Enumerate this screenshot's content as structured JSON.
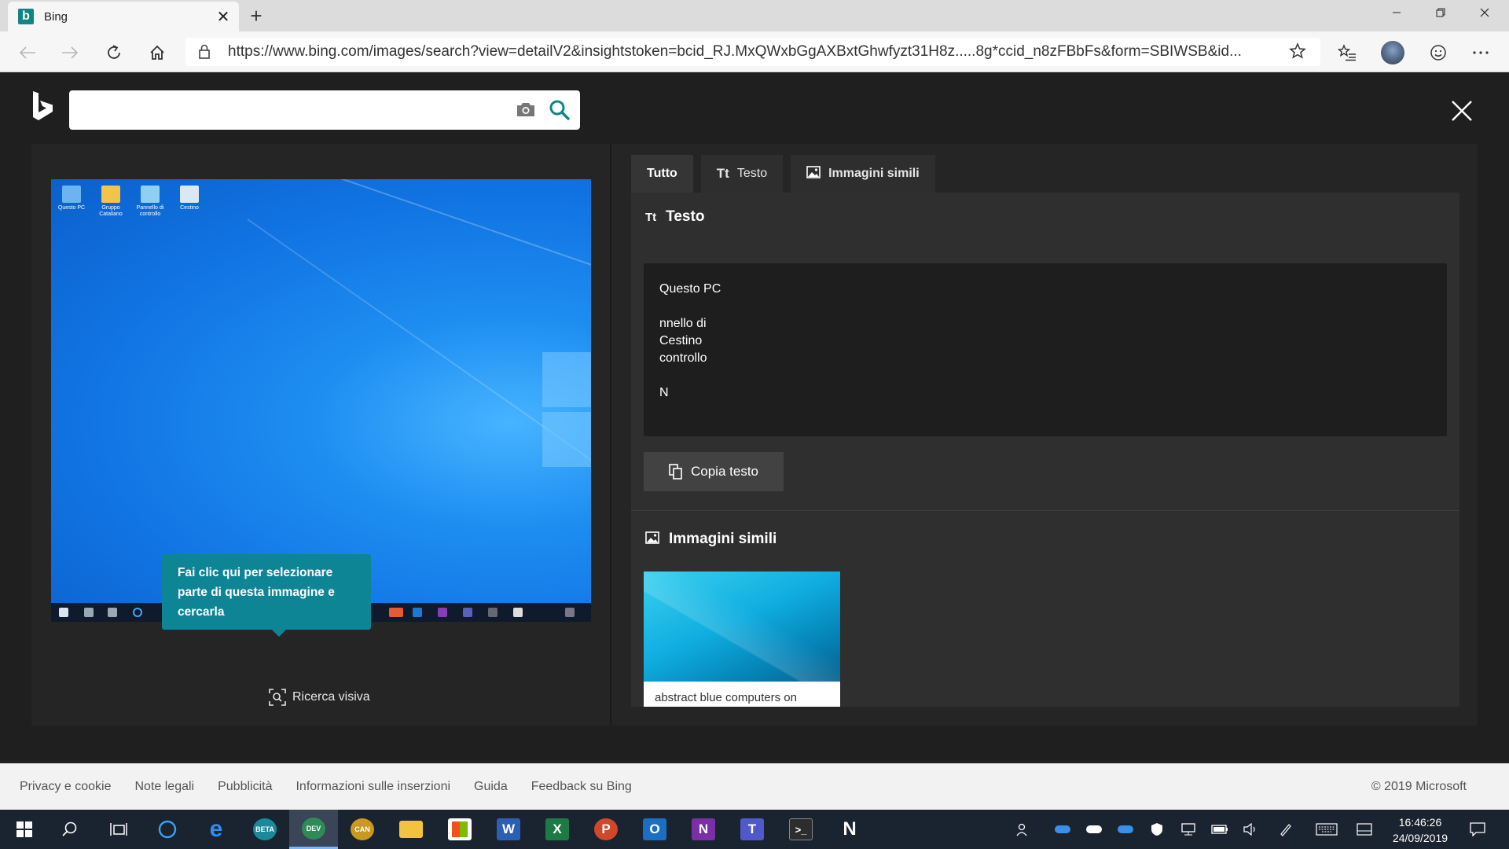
{
  "browser": {
    "tab_title": "Bing",
    "new_tab": "+",
    "url": "https://www.bing.com/images/search?view=detailV2&insightstoken=bcid_RJ.MxQWxbGgAXBxtGhwfyzt31H8z.....8g*ccid_n8zFBbFs&form=SBIWSB&id..."
  },
  "search": {
    "query": ""
  },
  "preview": {
    "desktop_icons": [
      "Questo PC",
      "Gruppo Cataliano",
      "Pannello di controllo",
      "Cestino"
    ],
    "tooltip": "Fai clic qui per selezionare parte di questa immagine e cercarla",
    "visual_search_label": "Ricerca visiva"
  },
  "tabs": [
    {
      "label": "Tutto",
      "icon": "none"
    },
    {
      "label": "Testo",
      "icon": "text-icon"
    },
    {
      "label": "Immagini simili",
      "icon": "image-icon"
    }
  ],
  "text_section": {
    "title": "Testo",
    "lines": [
      "Questo PC",
      "",
      "nnello di",
      "Cestino",
      "controllo",
      "",
      "N"
    ],
    "copy_button": "Copia testo"
  },
  "similar_section": {
    "title": "Immagini simili",
    "items": [
      {
        "caption": "abstract blue computers on"
      }
    ]
  },
  "footer": {
    "links": [
      "Privacy e cookie",
      "Note legali",
      "Pubblicità",
      "Informazioni sulle inserzioni",
      "Guida",
      "Feedback su Bing"
    ],
    "copyright": "© 2019 Microsoft"
  },
  "taskbar": {
    "time": "16:46:26",
    "date": "24/09/2019"
  },
  "colors": {
    "bing_teal": "#138484",
    "tooltip_teal": "#0e8595",
    "panel_dark": "#252525"
  }
}
